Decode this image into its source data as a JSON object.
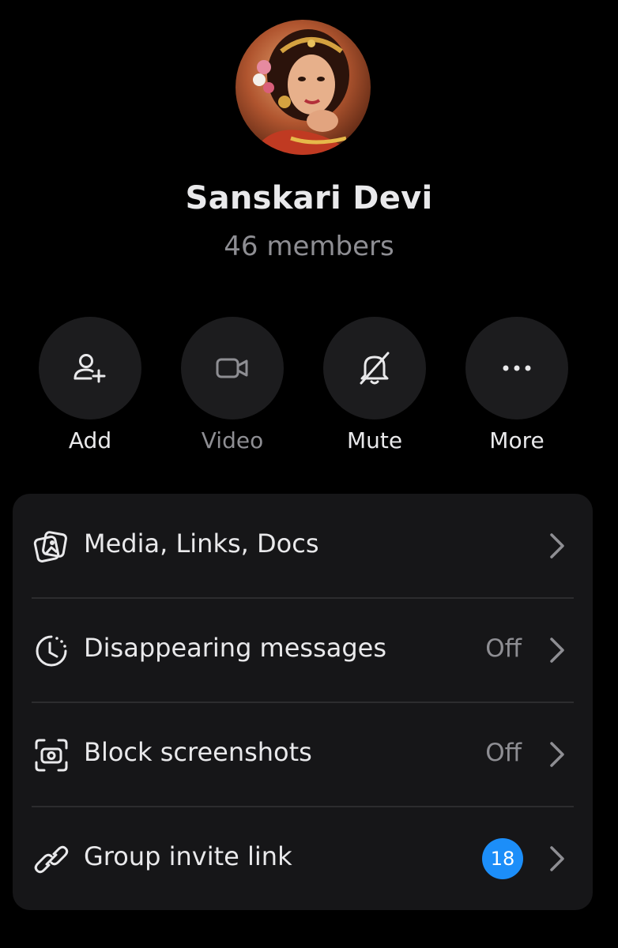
{
  "group": {
    "name": "Sanskari Devi",
    "member_count": "46 members"
  },
  "actions": [
    {
      "label": "Add",
      "icon": "add-person-icon",
      "enabled": true
    },
    {
      "label": "Video",
      "icon": "video-camera-icon",
      "enabled": false
    },
    {
      "label": "Mute",
      "icon": "bell-off-icon",
      "enabled": true
    },
    {
      "label": "More",
      "icon": "more-dots-icon",
      "enabled": true
    }
  ],
  "settings": {
    "rows": [
      {
        "label": "Media, Links, Docs",
        "icon": "media-gallery-icon",
        "value": ""
      },
      {
        "label": "Disappearing messages",
        "icon": "timer-icon",
        "value": "Off"
      },
      {
        "label": "Block screenshots",
        "icon": "screenshot-block-icon",
        "value": "Off"
      },
      {
        "label": "Group invite link",
        "icon": "link-icon",
        "badge": "18"
      }
    ]
  },
  "colors": {
    "background": "#000000",
    "card": "#161618",
    "button_circle": "#1c1c1e",
    "text_primary": "#e9e9eb",
    "text_secondary": "#8e8e93",
    "badge": "#1c8ef9"
  }
}
